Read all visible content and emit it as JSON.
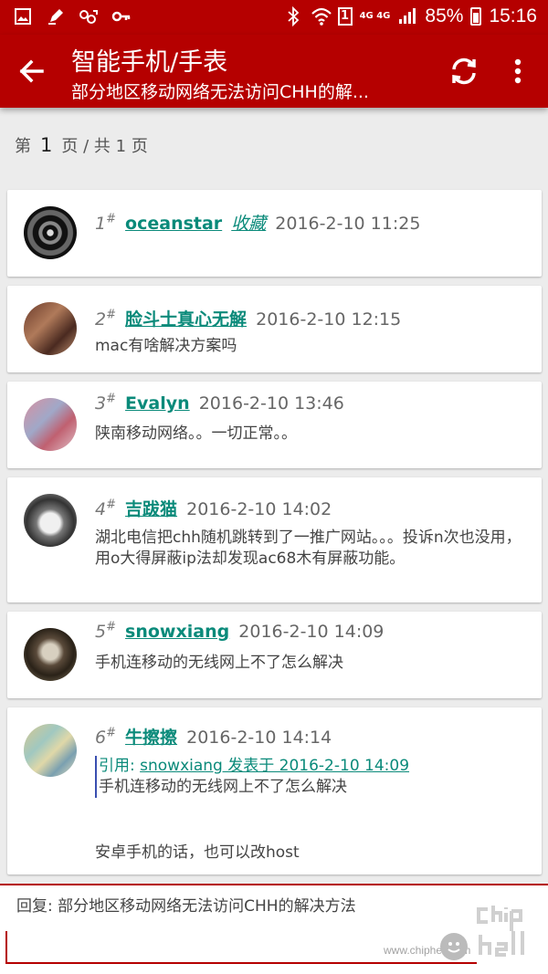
{
  "status_bar": {
    "left_icons": [
      "image-icon",
      "pen-icon",
      "link-icon",
      "key-icon"
    ],
    "right_icons": [
      "bluetooth-icon",
      "wifi-icon"
    ],
    "sim": "1",
    "network": "4G 4G",
    "battery": "85%",
    "time": "15:16"
  },
  "app_bar": {
    "title": "智能手机/手表",
    "subtitle": "部分地区移动网络无法访问CHH的解..."
  },
  "pager": {
    "prefix": "第",
    "current": "1",
    "middle": "页 / 共",
    "total": "1",
    "suffix": "页"
  },
  "posts": [
    {
      "floor": "1",
      "author": "oceanstar",
      "extra": "收藏",
      "date": "2016-2-10 11:25",
      "body": ""
    },
    {
      "floor": "2",
      "author": "脸斗士真心无解",
      "date": "2016-2-10 12:15",
      "body": "mac有啥解决方案吗"
    },
    {
      "floor": "3",
      "author": "Evalyn",
      "date": "2016-2-10 13:46",
      "body": "陕南移动网络。。一切正常。。"
    },
    {
      "floor": "4",
      "author": "吉跋猫",
      "date": "2016-2-10 14:02",
      "body": "湖北电信把chh随机跳转到了一推广网站。。。投诉n次也没用，用o大得屏蔽ip法却发现ac68木有屏蔽功能。"
    },
    {
      "floor": "5",
      "author": "snowxiang",
      "date": "2016-2-10 14:09",
      "body": "手机连移动的无线网上不了怎么解决"
    },
    {
      "floor": "6",
      "author": "牛擦擦",
      "date": "2016-2-10 14:14",
      "quote_prefix": "引用: ",
      "quote_link": "snowxiang 发表于 2016-2-10 14:09",
      "quote_text": "手机连移动的无线网上不了怎么解决",
      "body": "安卓手机的话，也可以改host"
    }
  ],
  "reply": {
    "label": "回复: 部分地区移动网络无法访问CHH的解决方法",
    "value": "",
    "watermark_url": "www.chiphell.com",
    "watermark_logo": "chip hell"
  },
  "colors": {
    "accent": "#b50000",
    "link": "#0a8a7a"
  }
}
